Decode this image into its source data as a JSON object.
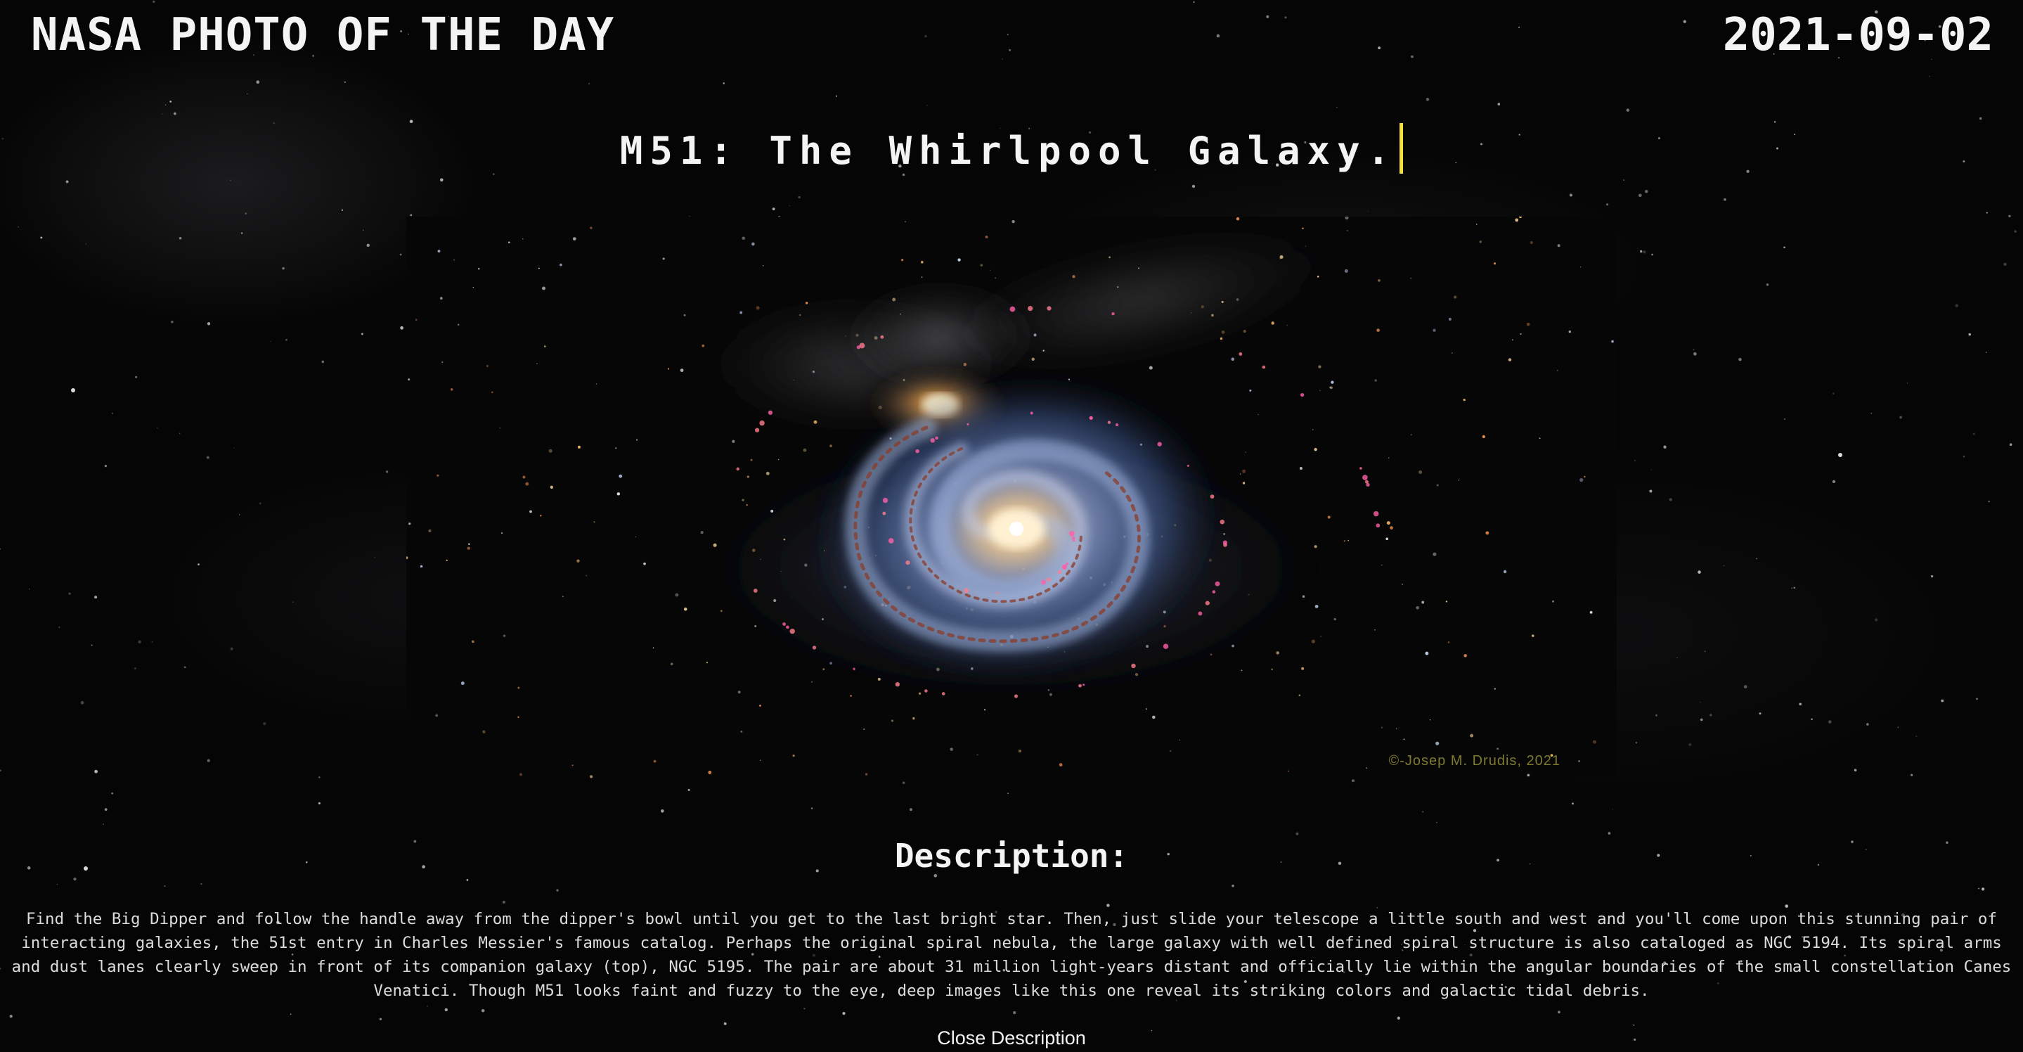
{
  "header": {
    "app_title": "NASA PHOTO OF THE DAY",
    "date": "2021-09-02"
  },
  "photo": {
    "title": "M51: The Whirlpool Galaxy.",
    "credit": "©-Josep M. Drudis, 2021",
    "subject_icon": "spiral-galaxy-image"
  },
  "description": {
    "heading": "Description:",
    "text": "Find the Big Dipper and follow the handle away from the dipper's bowl until you get to the last bright star. Then, just slide your telescope a little south and west and you'll come upon this stunning pair of interacting galaxies, the 51st entry in Charles Messier's famous catalog. Perhaps the original spiral nebula, the large galaxy with well defined spiral structure is also cataloged as NGC 5194. Its spiral arms and dust lanes clearly sweep in front of its companion galaxy (top), NGC 5195. The pair are about 31 million light-years distant and officially lie within the angular boundaries of the small constellation Canes Venatici. Though M51 looks faint and fuzzy to the eye, deep images like this one reveal its striking colors and galactic tidal debris.",
    "close_label": "Close Description"
  },
  "colors": {
    "background": "#000000",
    "text": "#f4f4f4",
    "cursor_accent": "#f3de3b",
    "credit": "#7d7a2e"
  }
}
